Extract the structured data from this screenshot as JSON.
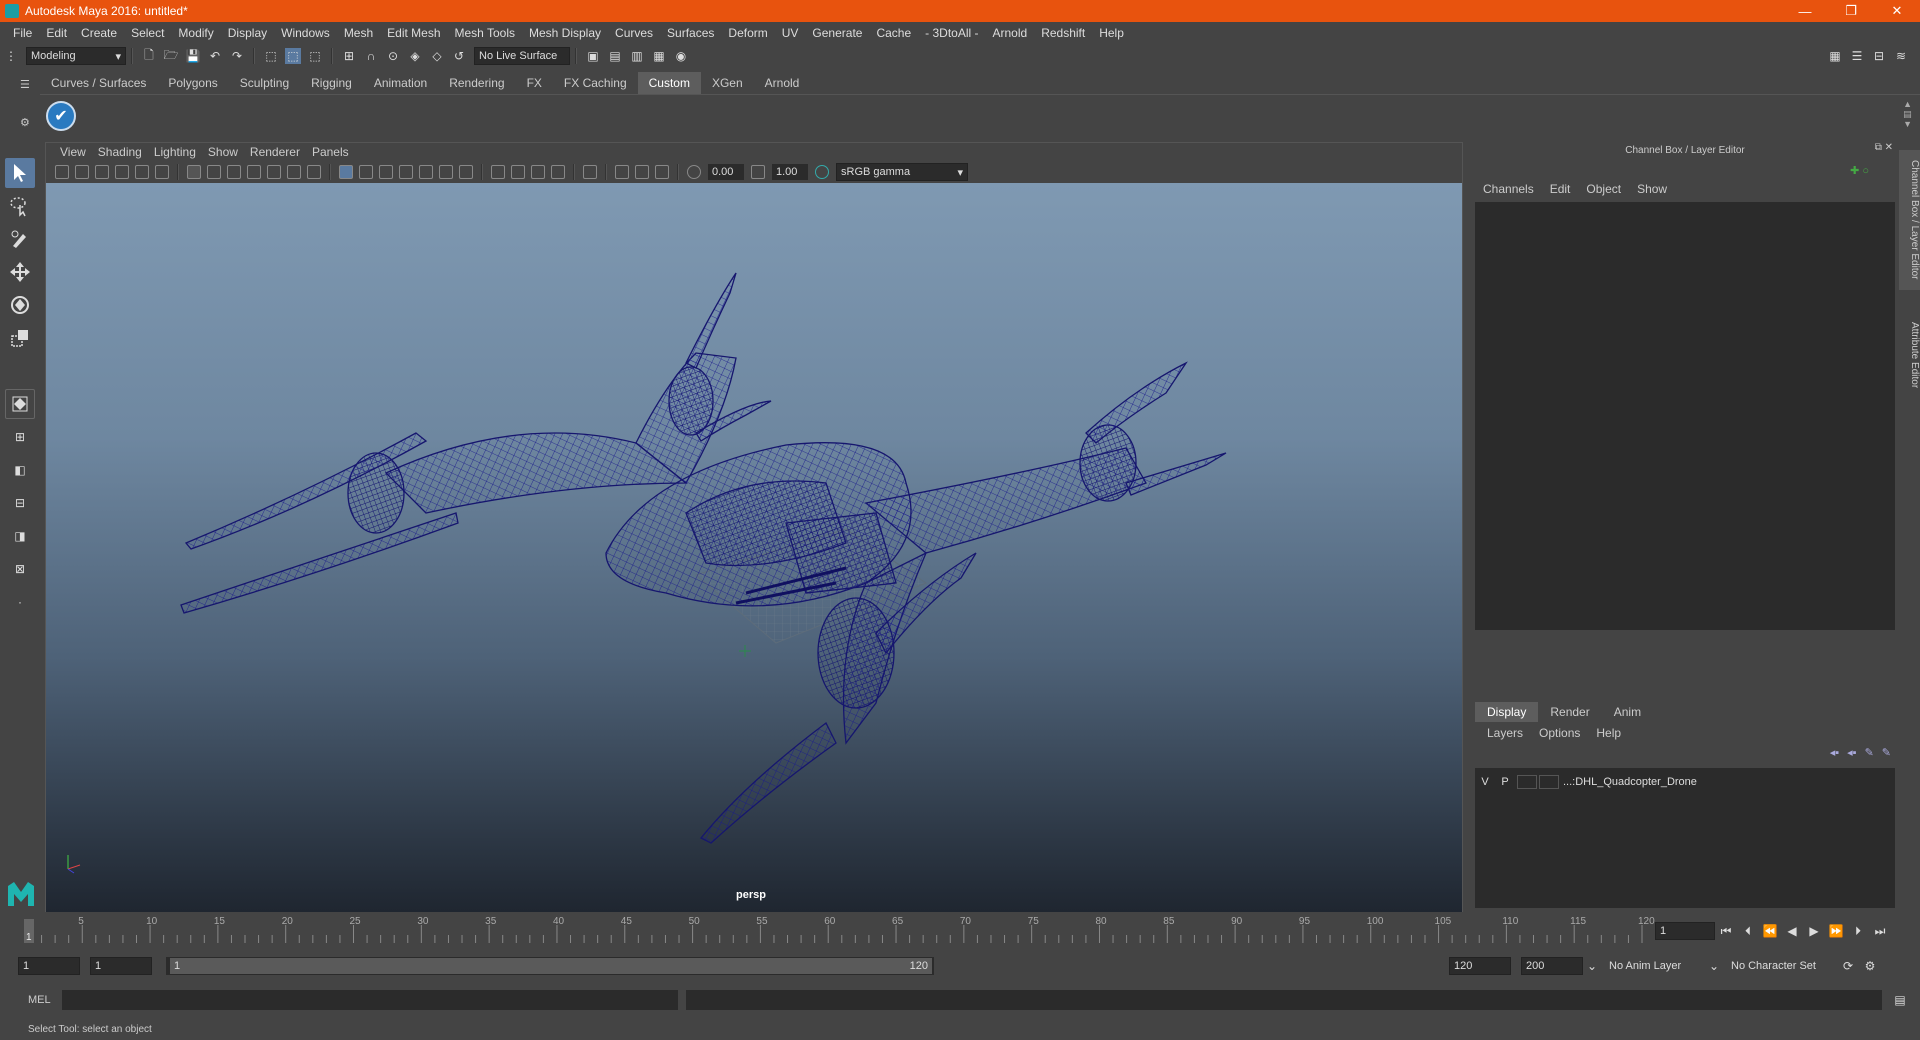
{
  "window": {
    "title": "Autodesk Maya 2016: untitled*",
    "minimize": "—",
    "restore": "❐",
    "close": "✕"
  },
  "menubar": [
    "File",
    "Edit",
    "Create",
    "Select",
    "Modify",
    "Display",
    "Windows",
    "Mesh",
    "Edit Mesh",
    "Mesh Tools",
    "Mesh Display",
    "Curves",
    "Surfaces",
    "Deform",
    "UV",
    "Generate",
    "Cache",
    "- 3DtoAll -",
    "Arnold",
    "Redshift",
    "Help"
  ],
  "statusline": {
    "mode": "Modeling",
    "live_surface": "No Live Surface"
  },
  "shelf": {
    "tabs": [
      "Curves / Surfaces",
      "Polygons",
      "Sculpting",
      "Rigging",
      "Animation",
      "Rendering",
      "FX",
      "FX Caching",
      "Custom",
      "XGen",
      "Arnold"
    ],
    "active_tab": "Custom"
  },
  "viewport": {
    "menu": [
      "View",
      "Shading",
      "Lighting",
      "Show",
      "Renderer",
      "Panels"
    ],
    "exposure": "0.00",
    "gamma": "1.00",
    "color_space": "sRGB gamma",
    "camera_label": "persp"
  },
  "channelbox": {
    "title": "Channel Box / Layer Editor",
    "menu": [
      "Channels",
      "Edit",
      "Object",
      "Show"
    ],
    "layer_tabs": [
      "Display",
      "Render",
      "Anim"
    ],
    "layer_menu": [
      "Layers",
      "Options",
      "Help"
    ],
    "layer": {
      "v": "V",
      "p": "P",
      "name": "...:DHL_Quadcopter_Drone"
    }
  },
  "side_tabs": [
    "Channel Box / Layer Editor",
    "Attribute Editor"
  ],
  "timeline": {
    "ticks": [
      "5",
      "10",
      "15",
      "20",
      "25",
      "30",
      "35",
      "40",
      "45",
      "50",
      "55",
      "60",
      "65",
      "70",
      "75",
      "80",
      "85",
      "90",
      "95",
      "100",
      "105",
      "110",
      "115",
      "120"
    ],
    "current_frame_marker": "1",
    "current_frame": "1"
  },
  "range": {
    "start": "1",
    "start_inner": "1",
    "slider_start": "1",
    "slider_end": "120",
    "end_inner": "120",
    "end": "200",
    "anim_layer": "No Anim Layer",
    "character_set": "No Character Set"
  },
  "cmdline": {
    "label": "MEL"
  },
  "helpline": {
    "text": "Select Tool: select an object"
  }
}
